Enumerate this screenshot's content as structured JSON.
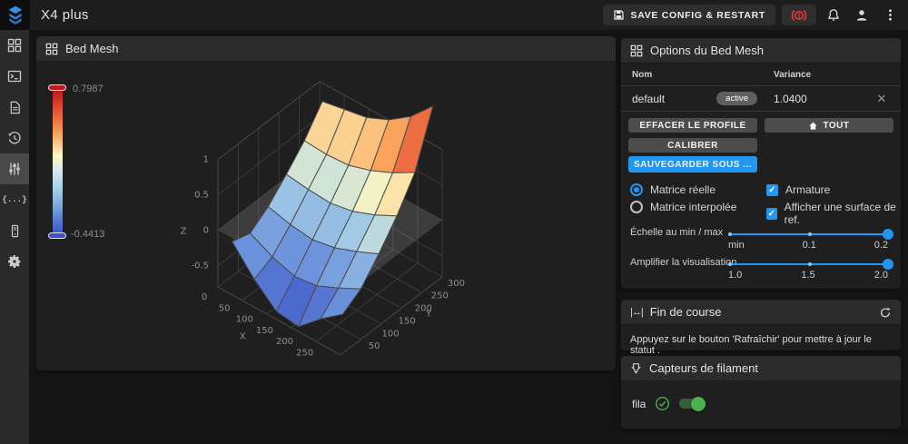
{
  "topbar": {
    "title": "X4 plus",
    "save_button_label": "SAVE CONFIG & RESTART"
  },
  "sidebar": {
    "items": [
      "dashboard",
      "console",
      "gcode-files",
      "history",
      "tune",
      "config-files",
      "machine",
      "settings"
    ],
    "active_item": "tune"
  },
  "bed_mesh_panel": {
    "title": "Bed Mesh",
    "colorbar_max": "0.7987",
    "colorbar_min": "-0.4413"
  },
  "chart_data": {
    "type": "surface",
    "title": "",
    "xlabel": "X",
    "ylabel": "Y",
    "zlabel": "Z",
    "x_range": [
      0,
      305
    ],
    "y_range": [
      0,
      310
    ],
    "x_ticks": [
      0,
      50,
      100,
      150,
      200,
      250
    ],
    "y_ticks": [
      50,
      100,
      150,
      200,
      250,
      300
    ],
    "z_ticks": [
      1,
      0.5,
      0,
      -0.5
    ],
    "x": [
      15,
      70,
      125,
      180,
      235,
      290
    ],
    "y": [
      25,
      80,
      135,
      190,
      245,
      300
    ],
    "z": [
      [
        -0.1,
        -0.28,
        -0.42,
        -0.44,
        -0.3,
        -0.18
      ],
      [
        -0.14,
        -0.22,
        -0.27,
        -0.25,
        -0.18,
        -0.1
      ],
      [
        -0.05,
        -0.09,
        -0.11,
        -0.08,
        -0.02,
        0.05
      ],
      [
        0.08,
        0.06,
        0.05,
        0.08,
        0.14,
        0.22
      ],
      [
        0.22,
        0.21,
        0.22,
        0.27,
        0.34,
        0.43
      ],
      [
        0.4,
        0.43,
        0.46,
        0.53,
        0.64,
        0.8
      ]
    ],
    "z_color_range": [
      -0.4413,
      0.7987
    ],
    "amplify": 2.0,
    "show_wireframe": true,
    "show_reference_plane": true,
    "reference_plane_z": 0,
    "legend_position": "left-colorbar",
    "grid": true,
    "colorscale": [
      [
        0,
        "#3a51c5"
      ],
      [
        0.2,
        "#688fdb"
      ],
      [
        0.4,
        "#a8d1e7"
      ],
      [
        0.54,
        "#fdf7c3"
      ],
      [
        0.7,
        "#fbac5f"
      ],
      [
        0.85,
        "#e64f35"
      ],
      [
        1,
        "#ba161e"
      ]
    ]
  },
  "options_panel": {
    "title": "Options du Bed Mesh",
    "table": {
      "col_name": "Nom",
      "col_variance": "Variance",
      "rows": [
        {
          "name": "default",
          "badge": "active",
          "variance": "1.0400"
        }
      ]
    },
    "buttons": {
      "clear_profile": "EFFACER LE PROFILE",
      "home_all": "TOUT",
      "calibrate": "CALIBRER",
      "save_as": "SAUVEGARDER SOUS ..."
    },
    "radio_group": [
      {
        "label": "Matrice réelle",
        "selected": true
      },
      {
        "label": "Matrice interpolée",
        "selected": false
      }
    ],
    "checkbox_group": [
      {
        "label": "Armature",
        "checked": true
      },
      {
        "label": "Afficher une surface de ref.",
        "checked": true
      }
    ],
    "sliders": [
      {
        "label": "Échelle au min / max",
        "tick_labels": [
          "min",
          "0.1",
          "0.2"
        ],
        "value": "0.2"
      },
      {
        "label": "Amplifier la visualisation",
        "tick_labels": [
          "1.0",
          "1.5",
          "2.0"
        ],
        "value": "2.0"
      }
    ]
  },
  "endstop_panel": {
    "title": "Fin de course",
    "message": "Appuyez sur le bouton 'Rafraîchir' pour mettre à jour le statut ."
  },
  "filament_panel": {
    "title": "Capteurs de filament",
    "sensors": [
      {
        "name": "fila",
        "detected": true,
        "enabled": true
      }
    ]
  },
  "colors": {
    "accent": "#2196f3",
    "success": "#4caf50",
    "danger": "#e53935"
  }
}
